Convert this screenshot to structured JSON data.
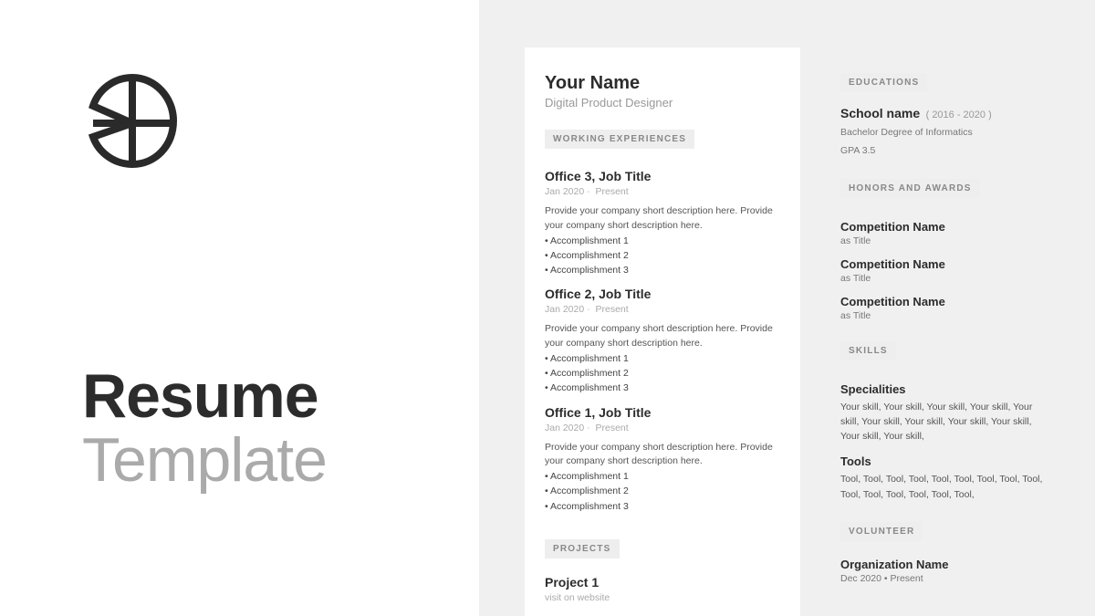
{
  "left": {
    "title1": "Resume",
    "title2": "Template"
  },
  "resume": {
    "name": "Your Name",
    "role": "Digital Product Designer",
    "labels": {
      "work": "WORKING EXPERIENCES",
      "projects": "PROJECTS",
      "education": "EDUCATIONS",
      "honors": "HONORS AND AWARDS",
      "skills": "SKILLS",
      "volunteer": "VOLUNTEER"
    },
    "jobs": [
      {
        "title": "Office 3, Job Title",
        "start": "Jan 2020",
        "end": "Present",
        "desc": "Provide your company short description here. Provide your company short description here.",
        "acc": [
          "Accomplishment 1",
          "Accomplishment 2",
          "Accomplishment 3"
        ]
      },
      {
        "title": "Office 2, Job Title",
        "start": "Jan 2020",
        "end": "Present",
        "desc": "Provide your company short description here. Provide your company short description here.",
        "acc": [
          "Accomplishment 1",
          "Accomplishment 2",
          "Accomplishment 3"
        ]
      },
      {
        "title": "Office 1, Job Title",
        "start": "Jan 2020",
        "end": "Present",
        "desc": "Provide your company short description here. Provide your company short description here.",
        "acc": [
          "Accomplishment 1",
          "Accomplishment 2",
          "Accomplishment 3"
        ]
      }
    ],
    "project": {
      "title": "Project 1",
      "sub": "visit on website"
    },
    "education": {
      "school": "School name",
      "years": "( 2016 - 2020 )",
      "degree": "Bachelor Degree of Informatics",
      "gpa": "GPA 3.5"
    },
    "honors": [
      {
        "name": "Competition Name",
        "sub": "as Title"
      },
      {
        "name": "Competition Name",
        "sub": "as Title"
      },
      {
        "name": "Competition Name",
        "sub": "as Title"
      }
    ],
    "skills": {
      "spec_head": "Specialities",
      "spec_body": "Your skill, Your skill, Your skill, Your skill, Your skill, Your skill, Your skill, Your skill, Your skill, Your skill, Your skill,",
      "tools_head": "Tools",
      "tools_body": "Tool, Tool, Tool, Tool, Tool, Tool, Tool, Tool, Tool, Tool, Tool, Tool, Tool, Tool, Tool,"
    },
    "volunteer": {
      "name": "Organization Name",
      "date": "Dec 2020 • Present"
    }
  }
}
